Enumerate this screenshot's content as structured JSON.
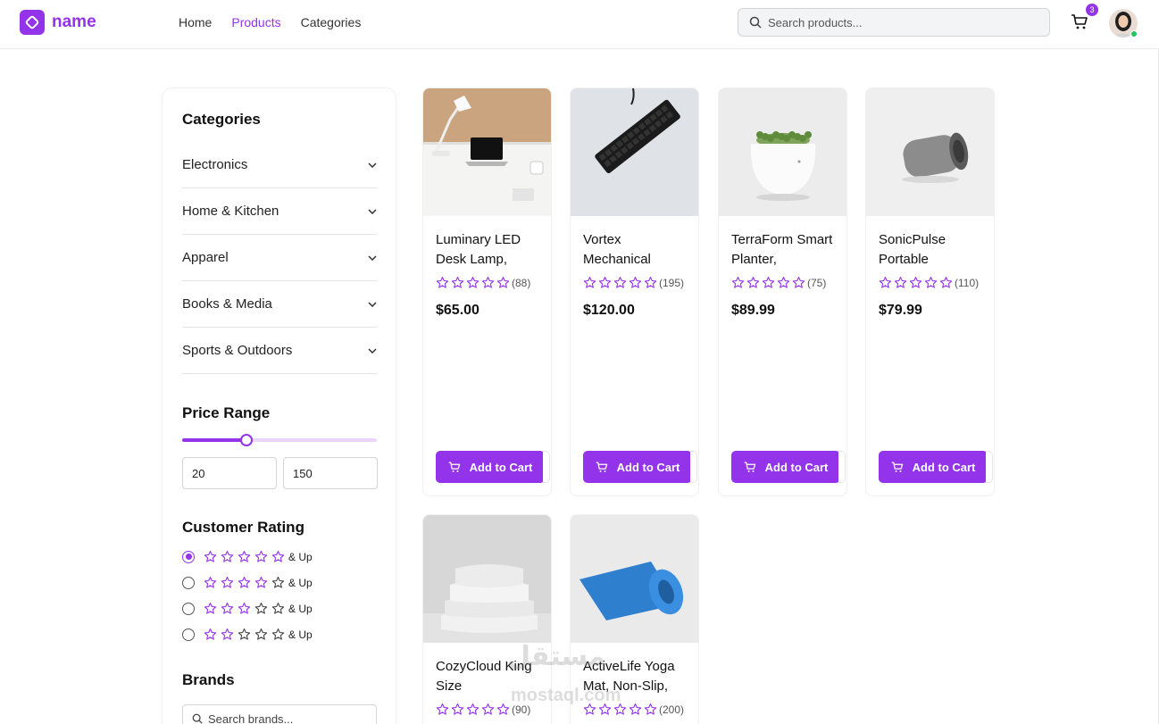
{
  "header": {
    "logo_text": "name",
    "nav": [
      "Home",
      "Products",
      "Categories"
    ],
    "active_nav": "Products",
    "search_placeholder": "Search products...",
    "cart_count": "3",
    "accent_color": "#9333ea"
  },
  "sidebar": {
    "categories_title": "Categories",
    "categories": [
      "Electronics",
      "Home & Kitchen",
      "Apparel",
      "Books & Media",
      "Sports & Outdoors"
    ],
    "price_title": "Price Range",
    "price_min": "20",
    "price_max": "150",
    "slider_fraction": 0.33,
    "rating_title": "Customer Rating",
    "rating_options": [
      {
        "stars": 5,
        "label": "& Up",
        "selected": true
      },
      {
        "stars": 4,
        "label": "& Up",
        "selected": false
      },
      {
        "stars": 3,
        "label": "& Up",
        "selected": false
      },
      {
        "stars": 2,
        "label": "& Up",
        "selected": false
      }
    ],
    "brands_title": "Brands",
    "brands_placeholder": "Search brands..."
  },
  "products": [
    {
      "name": "Luminary LED Desk Lamp,",
      "reviews": "(88)",
      "price": "$65.00",
      "button": "Add to Cart",
      "image": "desk-lamp-laptop"
    },
    {
      "name": "Vortex Mechanical",
      "reviews": "(195)",
      "price": "$120.00",
      "button": "Add to Cart",
      "image": "keyboard"
    },
    {
      "name": "TerraForm Smart Planter,",
      "reviews": "(75)",
      "price": "$89.99",
      "button": "Add to Cart",
      "image": "planter"
    },
    {
      "name": "SonicPulse Portable",
      "reviews": "(110)",
      "price": "$79.99",
      "button": "Add to Cart",
      "image": "speaker"
    },
    {
      "name": "CozyCloud King Size",
      "reviews": "(90)",
      "price": "",
      "button": "",
      "image": "pillows"
    },
    {
      "name": "ActiveLife Yoga Mat, Non-Slip,",
      "reviews": "(200)",
      "price": "",
      "button": "",
      "image": "yoga-mat"
    }
  ],
  "watermark": {
    "line1": "مستقل",
    "line2": "mostaql.com"
  }
}
